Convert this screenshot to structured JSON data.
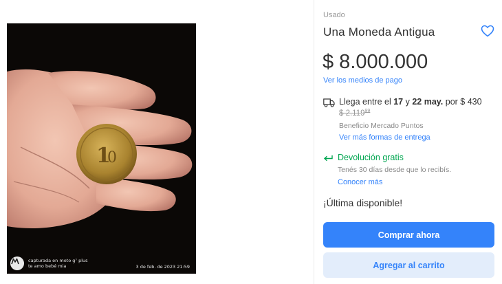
{
  "photo": {
    "watermark_line1": "capturada en moto g⁷ plus",
    "watermark_line2": "te amo bebé mia",
    "watermark_date": "3 de feb. de 2023 21:59",
    "logo_icon": "motorola-logo-icon",
    "subject": "hand-holding-coin-image"
  },
  "product": {
    "condition": "Usado",
    "title": "Una Moneda Antigua",
    "favorite_icon": "heart-icon",
    "price": "$ 8.000.000",
    "payment_link": "Ver los medios de pago"
  },
  "shipping": {
    "icon": "truck-icon",
    "prefix": "Llega entre el ",
    "date_from": "17",
    "conj": " y ",
    "date_to": "22 may.",
    "cost_text": " por $ 430",
    "old_price_main": "$ 2.119",
    "old_price_cents": "99",
    "benefit": "Beneficio Mercado Puntos",
    "more_link": "Ver más formas de entrega"
  },
  "returns": {
    "icon": "return-arrow-icon",
    "title": "Devolución gratis",
    "subtitle": "Tenés 30 días desde que lo recibís.",
    "link": "Conocer más"
  },
  "stock": "¡Última disponible!",
  "actions": {
    "buy_now": "Comprar ahora",
    "add_to_cart": "Agregar al carrito"
  },
  "colors": {
    "accent": "#3483fa",
    "accent_light": "#e3edfb",
    "success": "#00a650",
    "text": "#333333",
    "muted": "#999999"
  }
}
